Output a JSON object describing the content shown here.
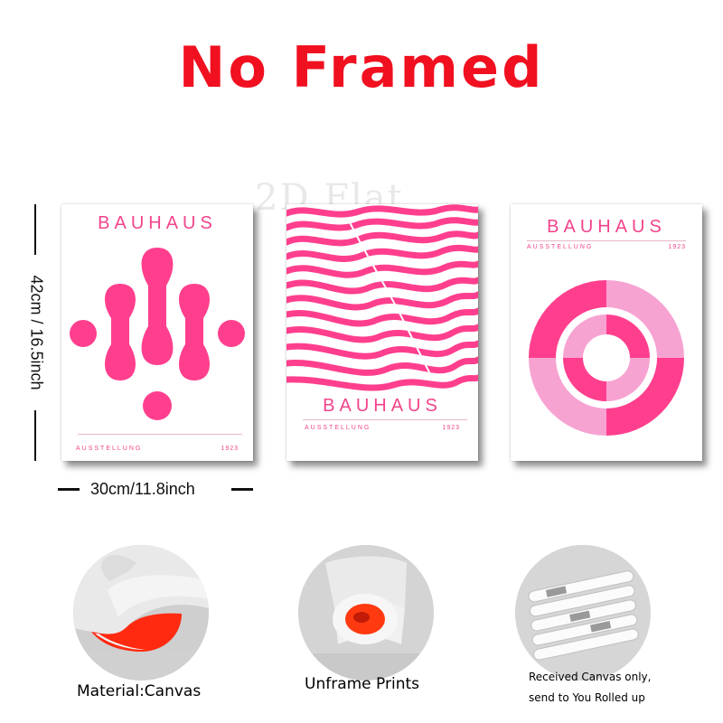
{
  "headline": "No Framed",
  "watermark": "2D Flat",
  "colors": {
    "headline": "#f01020",
    "pink": "#ff3f8e",
    "light_pink": "#f7a3d2",
    "orange_red": "#ff2a10"
  },
  "posters": [
    {
      "title": "BAUHAUS",
      "subtitle": "AUSSTELLUNG",
      "year": "1923"
    },
    {
      "title": "BAUHAUS",
      "subtitle": "AUSSTELLUNG",
      "year": "1923"
    },
    {
      "title": "BAUHAUS",
      "subtitle": "AUSSTELLUNG",
      "year": "1923"
    }
  ],
  "dimensions": {
    "height": "42cm / 16.5inch",
    "width": "30cm/11.8inch"
  },
  "features": [
    {
      "caption": "Material:Canvas",
      "photo": "canvas-curl"
    },
    {
      "caption": "Unframe  Prints",
      "photo": "canvas-roll"
    },
    {
      "caption_lines": [
        "Received Canvas only,",
        "send to You Rolled up"
      ],
      "photo": "rolled-tubes"
    }
  ]
}
